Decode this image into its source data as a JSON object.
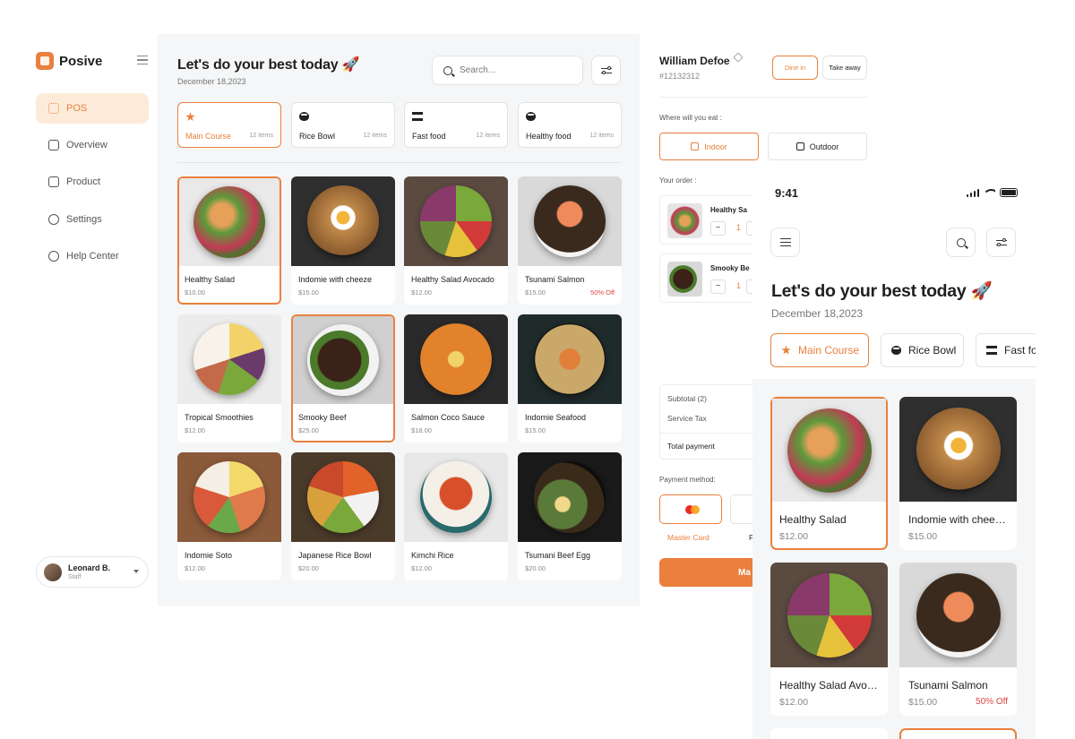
{
  "sidebar": {
    "brand": "Posive",
    "items": [
      {
        "label": "POS",
        "icon": "grid-icon",
        "active": true
      },
      {
        "label": "Overview",
        "icon": "chart-icon",
        "active": false
      },
      {
        "label": "Product",
        "icon": "box-icon",
        "active": false
      },
      {
        "label": "Settings",
        "icon": "gear-icon",
        "active": false
      },
      {
        "label": "Help Center",
        "icon": "info-icon",
        "active": false
      }
    ],
    "user": {
      "name": "Leonard B.",
      "role": "Staff"
    }
  },
  "main": {
    "title": "Let's do your best today 🚀",
    "date": "December 18,2023",
    "search_placeholder": "Search...",
    "categories": [
      {
        "label": "Main Course",
        "count": "12 items",
        "active": true
      },
      {
        "label": "Rice Bowl",
        "count": "12 items",
        "active": false
      },
      {
        "label": "Fast food",
        "count": "12 items",
        "active": false
      },
      {
        "label": "Healthy food",
        "count": "12 items",
        "active": false
      }
    ],
    "products": [
      {
        "name": "Healthy Salad",
        "price": "$10.00",
        "discount": ""
      },
      {
        "name": "Indomie with cheeze",
        "price": "$15.00",
        "discount": ""
      },
      {
        "name": "Healthy Salad Avocado",
        "price": "$12.00",
        "discount": ""
      },
      {
        "name": "Tsunami Salmon",
        "price": "$15.00",
        "discount": "50% Off"
      },
      {
        "name": "Tropical Smoothies",
        "price": "$12.00",
        "discount": ""
      },
      {
        "name": "Smooky Beef",
        "price": "$25.00",
        "discount": ""
      },
      {
        "name": "Salmon Coco Sauce",
        "price": "$18.00",
        "discount": ""
      },
      {
        "name": "Indomie Seafood",
        "price": "$15.00",
        "discount": ""
      },
      {
        "name": "Indomie Soto",
        "price": "$12.00",
        "discount": ""
      },
      {
        "name": "Japanese Rice Bowl",
        "price": "$20.00",
        "discount": ""
      },
      {
        "name": "Kimchi Rice",
        "price": "$12.00",
        "discount": ""
      },
      {
        "name": "Tsumani Beef Egg",
        "price": "$20.00",
        "discount": ""
      }
    ]
  },
  "order": {
    "customer": "William Defoe",
    "order_id": "#12132312",
    "dine_in": "Dine in",
    "take_away": "Take away",
    "where_label": "Where will you eat :",
    "indoor": "Indoor",
    "outdoor": "Outdoor",
    "your_order_label": "Your order :",
    "items": [
      {
        "name": "Healthy Sa",
        "qty": "1"
      },
      {
        "name": "Smooky Be",
        "qty": "1"
      }
    ],
    "subtotal": "Subtotal (2)",
    "service_tax": "Service Tax",
    "total_payment": "Total payment",
    "payment_label": "Payment method:",
    "payment_selected": "Master Card",
    "payment_next_partial": "P",
    "pay_button_partial": "Ma"
  },
  "mobile": {
    "time": "9:41",
    "title": "Let's do your best today 🚀",
    "date": "December 18,2023",
    "categories": [
      {
        "label": "Main Course",
        "active": true
      },
      {
        "label": "Rice Bowl",
        "active": false
      },
      {
        "label": "Fast fo",
        "active": false
      }
    ],
    "products": [
      {
        "name": "Healthy Salad",
        "price": "$12.00",
        "discount": ""
      },
      {
        "name": "Indomie with chee…",
        "price": "$15.00",
        "discount": ""
      },
      {
        "name": "Healthy Salad Avo…",
        "price": "$12.00",
        "discount": ""
      },
      {
        "name": "Tsunami Salmon",
        "price": "$15.00",
        "discount": "50% Off"
      }
    ]
  },
  "colors": {
    "accent": "#e9803e",
    "discount": "#e04444",
    "panel_bg": "#f5f6f7"
  }
}
